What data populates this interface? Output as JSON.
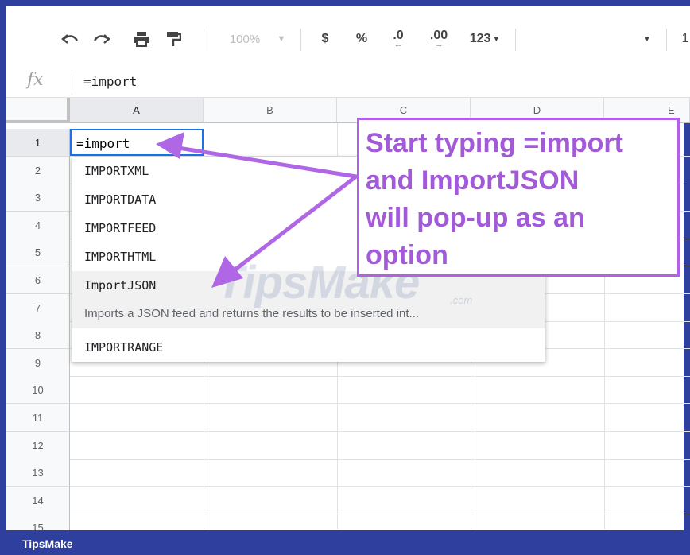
{
  "toolbar": {
    "zoom": "100%",
    "currency": "$",
    "percent": "%",
    "decrease_decimals": ".0",
    "increase_decimals": ".00",
    "number_format": "123",
    "font_size_partial": "1"
  },
  "formula_bar": {
    "fx_label": "fx",
    "value": "=import"
  },
  "columns": [
    "A",
    "B",
    "C",
    "D",
    "E"
  ],
  "rows": [
    "1",
    "2",
    "3",
    "4",
    "5",
    "6",
    "7",
    "8",
    "9",
    "10",
    "11",
    "12",
    "13",
    "14",
    "15"
  ],
  "active_cell": {
    "text": "=import"
  },
  "suggestions": {
    "items": [
      "IMPORTXML",
      "IMPORTDATA",
      "IMPORTFEED",
      "IMPORTHTML",
      "ImportJSON"
    ],
    "highlighted_description": "Imports a JSON feed and returns the results to be inserted int...",
    "last_item": "IMPORTRANGE"
  },
  "annotation": {
    "text": "Start typing =import\nand ImportJSON\nwill pop-up as an\noption",
    "color": "#a35ad8"
  },
  "watermark": {
    "text": "TipsMake",
    "suffix": ".com"
  },
  "footer": {
    "brand": "TipsMake",
    "color": "#2f3f9e"
  }
}
